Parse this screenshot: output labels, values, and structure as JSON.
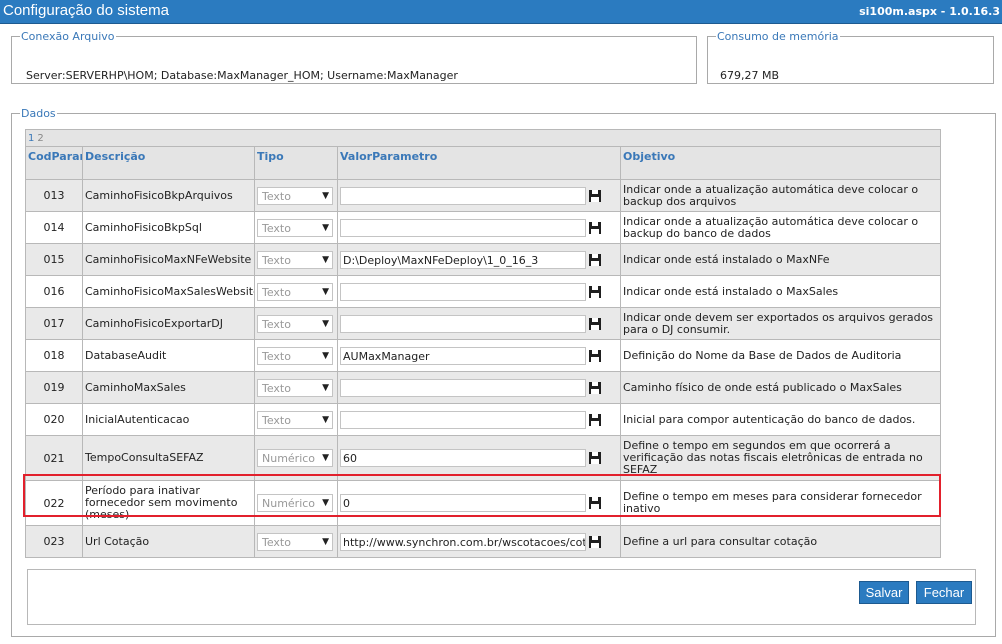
{
  "window": {
    "title": "Configuração do sistema",
    "page_info": "si100m.aspx - 1.0.16.3"
  },
  "connection": {
    "legend": "Conexão Arquivo",
    "text": "Server:SERVERHP\\HOM; Database:MaxManager_HOM; Username:MaxManager"
  },
  "memory": {
    "legend": "Consumo de memória",
    "value": "679,27 MB"
  },
  "dados": {
    "legend": "Dados",
    "pager": [
      "1",
      "2"
    ],
    "columns": [
      "CodParam",
      "Descrição",
      "Tipo",
      "ValorParametro",
      "Objetivo"
    ],
    "rows": [
      {
        "code": "013",
        "desc": "CaminhoFisicoBkpArquivos",
        "type": "Texto",
        "value": "",
        "objective": "Indicar onde a atualização automática deve colocar o backup dos arquivos"
      },
      {
        "code": "014",
        "desc": "CaminhoFisicoBkpSql",
        "type": "Texto",
        "value": "",
        "objective": "Indicar onde a atualização automática deve colocar o backup do banco de dados"
      },
      {
        "code": "015",
        "desc": "CaminhoFisicoMaxNFeWebsite",
        "type": "Texto",
        "value": "D:\\Deploy\\MaxNFeDeploy\\1_0_16_3",
        "objective": "Indicar onde está instalado o MaxNFe"
      },
      {
        "code": "016",
        "desc": "CaminhoFisicoMaxSalesWebsite",
        "type": "Texto",
        "value": "",
        "objective": "Indicar onde está instalado o MaxSales"
      },
      {
        "code": "017",
        "desc": "CaminhoFisicoExportarDJ",
        "type": "Texto",
        "value": "",
        "objective": "Indicar onde devem ser exportados os arquivos gerados para o DJ consumir."
      },
      {
        "code": "018",
        "desc": "DatabaseAudit",
        "type": "Texto",
        "value": "AUMaxManager",
        "objective": "Definição do Nome da Base de Dados de Auditoria"
      },
      {
        "code": "019",
        "desc": "CaminhoMaxSales",
        "type": "Texto",
        "value": "",
        "objective": "Caminho físico de onde está publicado o MaxSales"
      },
      {
        "code": "020",
        "desc": "InicialAutenticacao",
        "type": "Texto",
        "value": "",
        "objective": "Inicial para compor autenticação do banco de dados."
      },
      {
        "code": "021",
        "desc": "TempoConsultaSEFAZ",
        "type": "Numérico",
        "value": "60",
        "objective": "Define o tempo em segundos em que ocorrerá a verificação das notas fiscais eletrônicas de entrada no SEFAZ"
      },
      {
        "code": "022",
        "desc": "Período para inativar fornecedor sem movimento (meses)",
        "type": "Numérico",
        "value": "0",
        "objective": "Define o tempo em meses para considerar fornecedor inativo"
      },
      {
        "code": "023",
        "desc": "Url Cotação",
        "type": "Texto",
        "value": "http://www.synchron.com.br/wscotacoes/cotacoes.asmx",
        "objective": "Define a url para consultar cotação"
      }
    ]
  },
  "actions": {
    "save_label": "Salvar",
    "close_label": "Fechar"
  },
  "colors": {
    "accent": "#2b7bc0",
    "highlight": "#e2202c"
  }
}
